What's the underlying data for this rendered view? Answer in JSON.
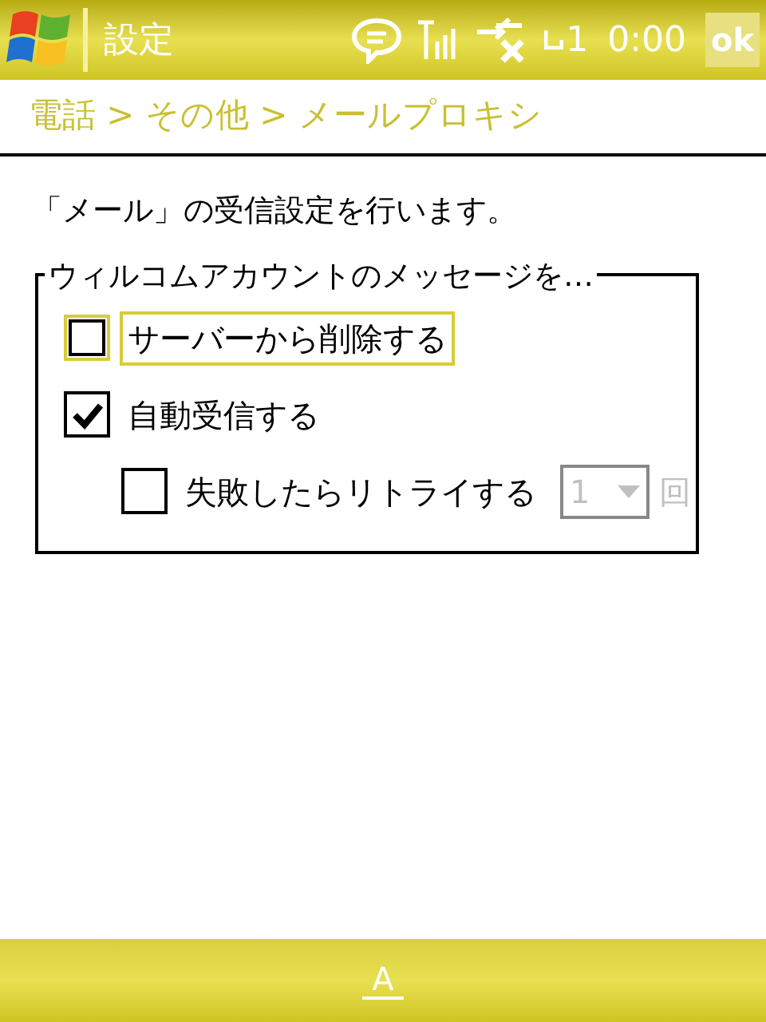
{
  "title_bar": {
    "title": "設定",
    "line_number": "1",
    "time": "0:00",
    "ok_button": "ok"
  },
  "breadcrumb": "電話 > その他 > メールプロキシ",
  "description": "「メール」の受信設定を行います。",
  "group": {
    "label": "ウィルコムアカウントのメッセージを…",
    "options": [
      {
        "label": "サーバーから削除する",
        "checked": false,
        "focused": true
      },
      {
        "label": "自動受信する",
        "checked": true,
        "focused": false,
        "children": [
          {
            "label": "失敗したらリトライする",
            "checked": false,
            "focused": false,
            "retry": {
              "value": "1",
              "unit": "回",
              "disabled": true
            }
          }
        ]
      }
    ]
  },
  "bottom_bar": {
    "input_button": "A"
  }
}
